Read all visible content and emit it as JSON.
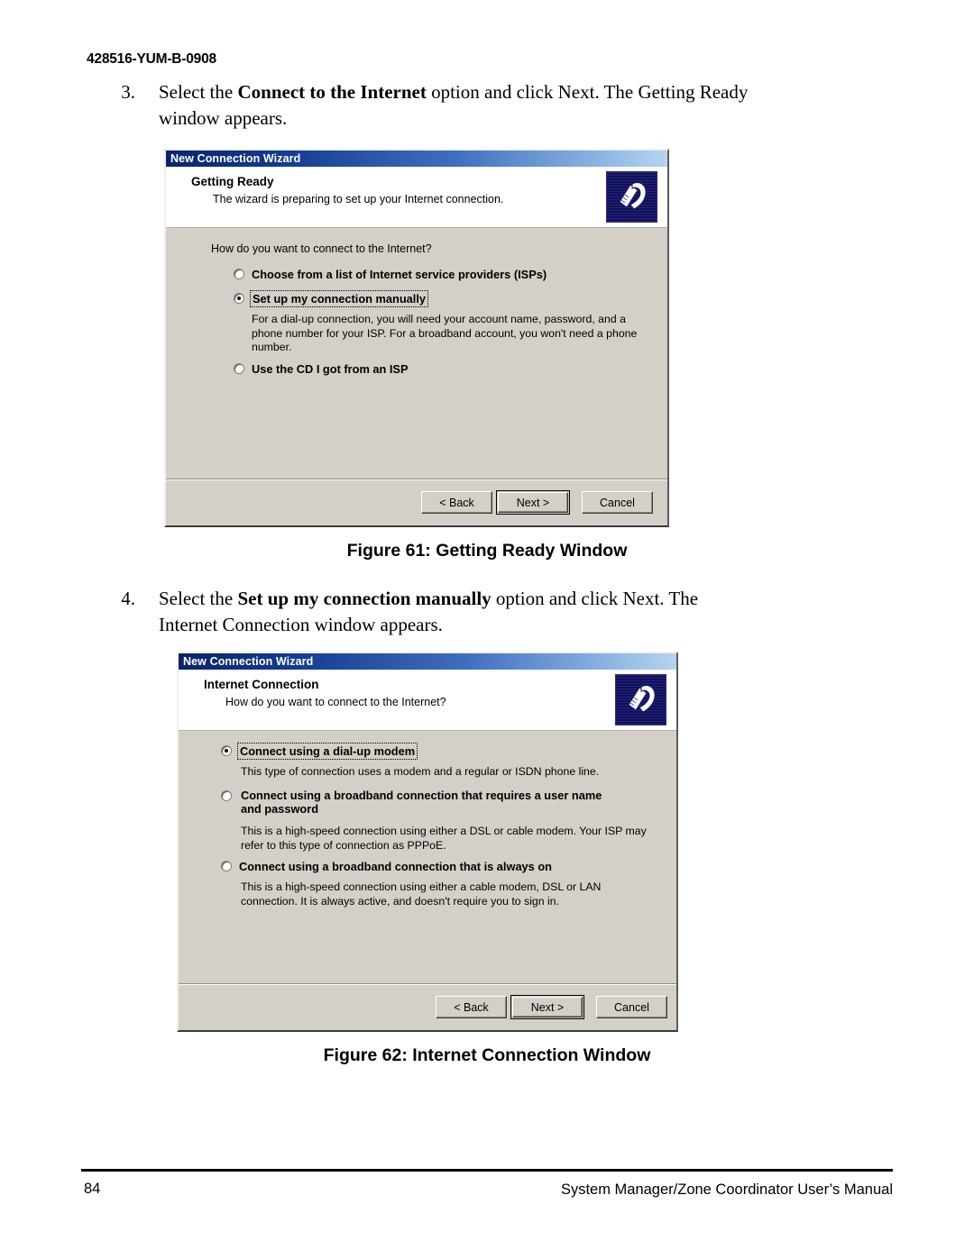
{
  "page": {
    "doc_id": "428516-YUM-B-0908",
    "page_number": "84",
    "footer_title": "System Manager/Zone Coordinator User’s Manual"
  },
  "steps": [
    {
      "number": "3.",
      "before": "Select the ",
      "bold": "Connect to the Internet",
      "after": " option and click Next. The Getting Ready window appears."
    },
    {
      "number": "4.",
      "before": "Select the ",
      "bold": "Set up my connection manually",
      "after": " option and click Next. The Internet Connection window appears."
    }
  ],
  "captions": {
    "figure_61": "Figure 61: Getting Ready Window",
    "figure_62": "Figure 62: Internet Connection Window"
  },
  "dialog1": {
    "title": "New Connection Wizard",
    "header_title": "Getting Ready",
    "header_subtitle": "The wizard is preparing to set up your Internet connection.",
    "icon": "modem-phone-icon",
    "prompt": "How do you want to connect to the Internet?",
    "options": [
      {
        "label": "Choose from a list of Internet service providers (ISPs)",
        "accel": "l",
        "selected": false,
        "focused": false,
        "description": ""
      },
      {
        "label": "Set up my connection manually",
        "accel": "m",
        "selected": true,
        "focused": true,
        "description": "For a dial-up connection, you will need your account name, password, and a phone number for your ISP. For a broadband account, you won't need a phone number."
      },
      {
        "label": "Use the CD I got from an ISP",
        "accel": "C",
        "selected": false,
        "focused": false,
        "description": ""
      }
    ],
    "buttons": {
      "back": "< Back",
      "next": "Next >",
      "cancel": "Cancel",
      "default_button": "next"
    }
  },
  "dialog2": {
    "title": "New Connection Wizard",
    "header_title": "Internet Connection",
    "header_subtitle": "How do you want to connect to the Internet?",
    "icon": "modem-phone-icon",
    "prompt": "",
    "options": [
      {
        "label": "Connect using a dial-up modem",
        "accel": "d",
        "selected": true,
        "focused": true,
        "description": "This type of connection uses a modem and a regular or ISDN phone line."
      },
      {
        "label": "Connect using a broadband connection that requires a user name and password",
        "accel": "u",
        "selected": false,
        "focused": false,
        "description": "This is a high-speed connection using either a DSL or cable modem. Your ISP may refer to this type of connection as PPPoE."
      },
      {
        "label": "Connect using a broadband connection that is always on",
        "accel": "a",
        "selected": false,
        "focused": false,
        "description": "This is a high-speed connection using either a cable modem, DSL or LAN connection. It is always active, and doesn't require you to sign in."
      }
    ],
    "buttons": {
      "back": "< Back",
      "next": "Next >",
      "cancel": "Cancel",
      "default_button": "next"
    }
  },
  "colors": {
    "titlebar_start": "#0a246a",
    "titlebar_end": "#b7d4f0",
    "dialog_face": "#d4d0c8",
    "header_bg": "#ffffff",
    "icon_bg": "#101060"
  }
}
